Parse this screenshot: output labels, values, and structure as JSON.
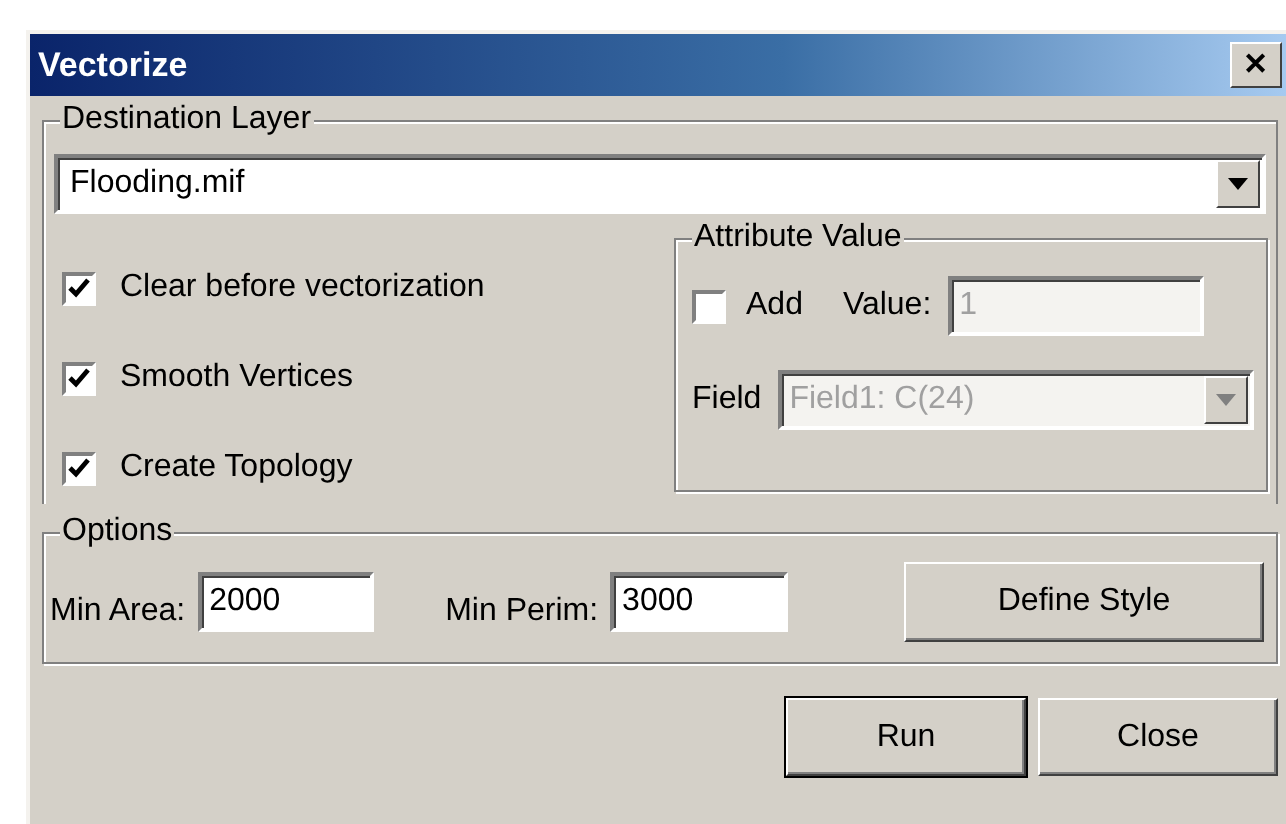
{
  "window": {
    "title": "Vectorize",
    "close_glyph": "✕"
  },
  "destination_layer": {
    "legend": "Destination Layer",
    "value": "Flooding.mif"
  },
  "checkboxes": [
    {
      "label": "Clear before vectorization",
      "checked": true
    },
    {
      "label": "Smooth Vertices",
      "checked": true
    },
    {
      "label": "Create Topology",
      "checked": true
    }
  ],
  "attribute_value": {
    "legend": "Attribute Value",
    "add": {
      "label": "Add",
      "checked": false
    },
    "value_label": "Value:",
    "value": "1",
    "value_disabled": true,
    "field_label": "Field",
    "field_value": "Field1: C(24)",
    "field_disabled": true
  },
  "options": {
    "legend": "Options",
    "min_area_label": "Min Area:",
    "min_area": "2000",
    "min_perim_label": "Min Perim:",
    "min_perim": "3000",
    "define_style": "Define Style"
  },
  "buttons": [
    {
      "label": "Run",
      "default": true
    },
    {
      "label": "Close",
      "default": false
    }
  ]
}
